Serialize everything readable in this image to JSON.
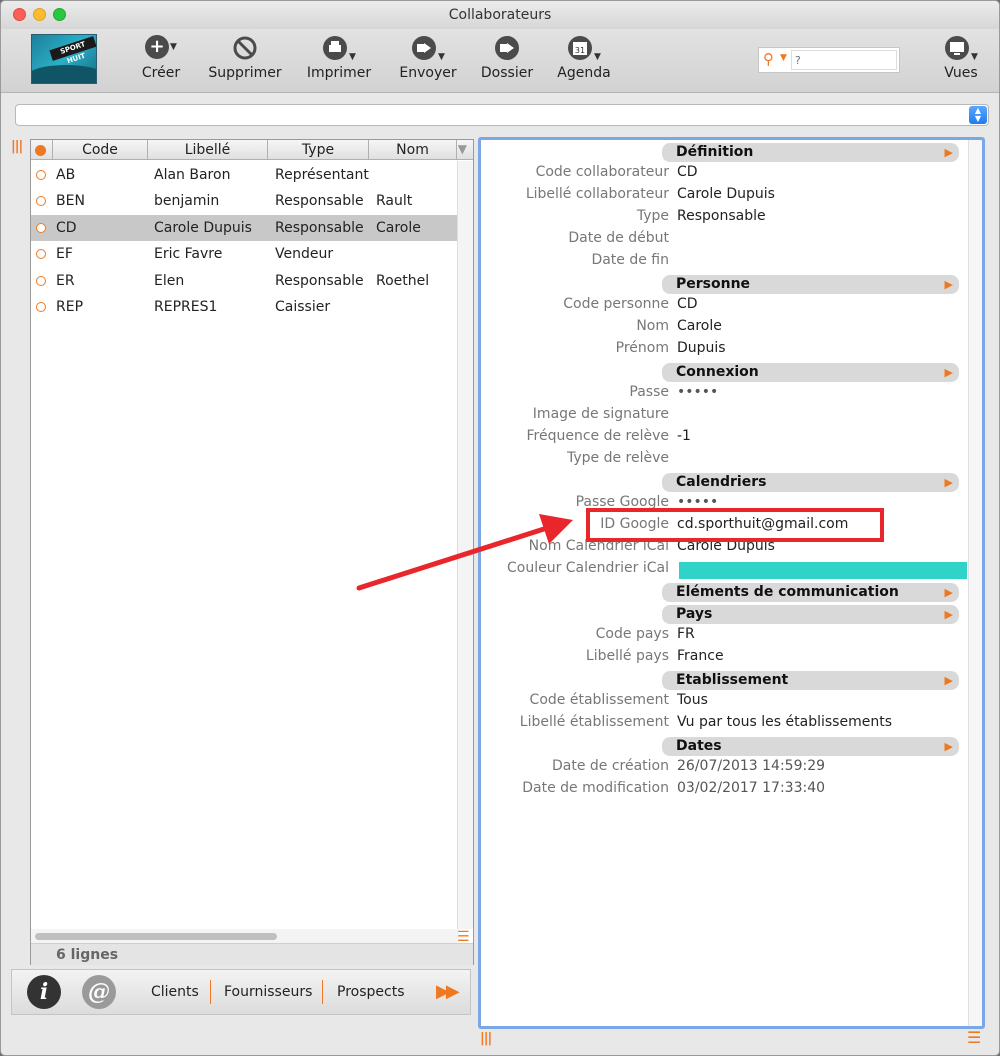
{
  "window": {
    "title": "Collaborateurs"
  },
  "logo": {
    "text": "SPORT HUIT"
  },
  "toolbar": {
    "create": "Créer",
    "delete": "Supprimer",
    "print": "Imprimer",
    "send": "Envoyer",
    "folder": "Dossier",
    "agenda": "Agenda",
    "calendar_day": "31",
    "views": "Vues",
    "search_placeholder": "?"
  },
  "list": {
    "columns": [
      "Code",
      "Libellé",
      "Type",
      "Nom"
    ],
    "rows": [
      {
        "code": "AB",
        "libelle": "Alan Baron",
        "type": "Représentant",
        "nom": ""
      },
      {
        "code": "BEN",
        "libelle": "benjamin",
        "type": "Responsable",
        "nom": "Rault"
      },
      {
        "code": "CD",
        "libelle": "Carole Dupuis",
        "type": "Responsable",
        "nom": "Carole"
      },
      {
        "code": "EF",
        "libelle": "Eric Favre",
        "type": "Vendeur",
        "nom": ""
      },
      {
        "code": "ER",
        "libelle": "Elen",
        "type": "Responsable",
        "nom": "Roethel"
      },
      {
        "code": "REP",
        "libelle": "REPRES1",
        "type": "Caissier",
        "nom": ""
      }
    ],
    "selected_index": 2,
    "count": "6 lignes"
  },
  "bottom_nav": {
    "info": "i",
    "at": "@",
    "links": [
      "Clients",
      "Fournisseurs",
      "Prospects"
    ]
  },
  "detail": {
    "definition": {
      "title": "Définition",
      "code_collab_label": "Code collaborateur",
      "code_collab": "CD",
      "libelle_collab_label": "Libellé collaborateur",
      "libelle_collab": "Carole Dupuis",
      "type_label": "Type",
      "type": "Responsable",
      "date_debut_label": "Date de début",
      "date_fin_label": "Date de fin"
    },
    "personne": {
      "title": "Personne",
      "code_personne_label": "Code personne",
      "code_personne": "CD",
      "nom_label": "Nom",
      "nom": "Carole",
      "prenom_label": "Prénom",
      "prenom": "Dupuis"
    },
    "connexion": {
      "title": "Connexion",
      "passe_label": "Passe",
      "passe": "•••••",
      "image_signature_label": "Image de signature",
      "frequence_label": "Fréquence de relève",
      "frequence": "-1",
      "type_releve_label": "Type de relève"
    },
    "calendriers": {
      "title": "Calendriers",
      "passe_google_label": "Passe Google",
      "passe_google": "•••••",
      "id_google_label": "ID Google",
      "id_google": "cd.sporthuit@gmail.com",
      "nom_ical_label": "Nom Calendrier iCal",
      "nom_ical": "Carole Dupuis",
      "couleur_ical_label": "Couleur Calendrier iCal",
      "couleur_ical": "#2fd3c8"
    },
    "communication": {
      "title": "Eléments de communication"
    },
    "pays": {
      "title": "Pays",
      "code_pays_label": "Code pays",
      "code_pays": "FR",
      "libelle_pays_label": "Libellé pays",
      "libelle_pays": "France"
    },
    "etablissement": {
      "title": "Etablissement",
      "code_etab_label": "Code établissement",
      "code_etab": "Tous",
      "libelle_etab_label": "Libellé établissement",
      "libelle_etab": "Vu par tous les établissements"
    },
    "dates": {
      "title": "Dates",
      "creation_label": "Date de création",
      "creation": "26/07/2013 14:59:29",
      "modification_label": "Date de modification",
      "modification": "03/02/2017 17:33:40"
    }
  },
  "colors": {
    "accent": "#f07820",
    "highlight": "#e8262b",
    "selection": "#c8c8c8"
  }
}
